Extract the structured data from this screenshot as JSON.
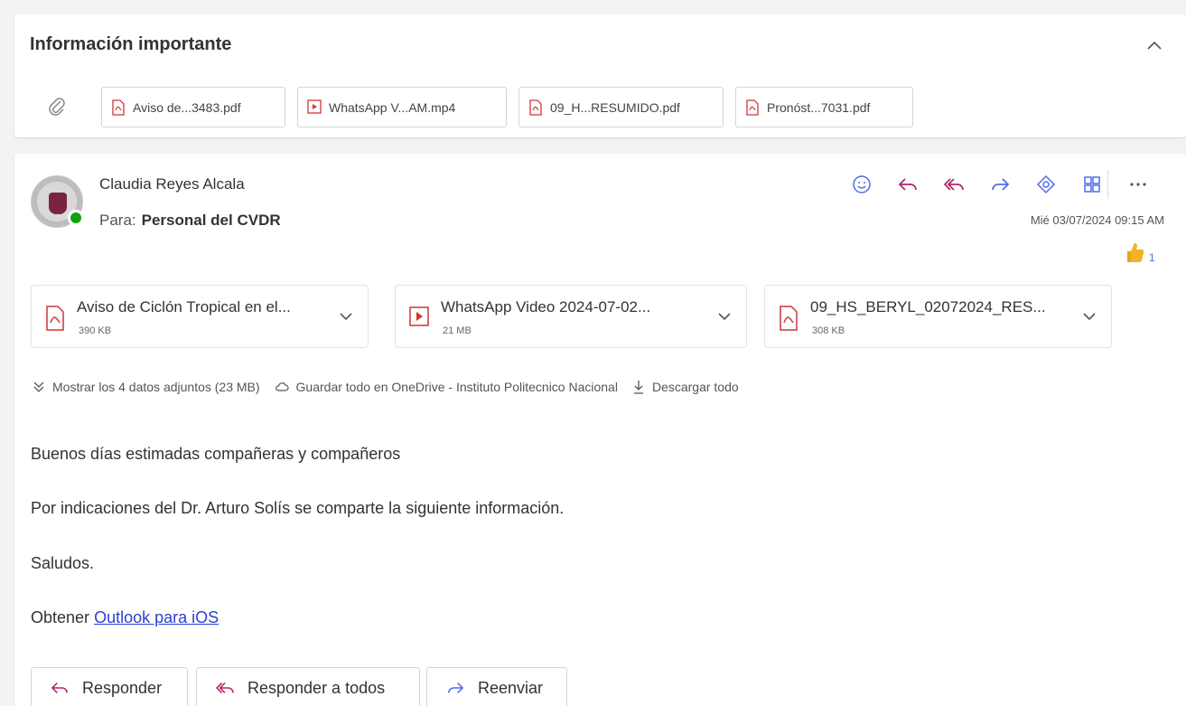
{
  "thread": {
    "subject": "Información importante",
    "attachment_chips": [
      {
        "label": "Aviso de...3483.pdf",
        "icon": "pdf-icon"
      },
      {
        "label": "WhatsApp V...AM.mp4",
        "icon": "video-icon"
      },
      {
        "label": "09_H...RESUMIDO.pdf",
        "icon": "pdf-icon"
      },
      {
        "label": "Pronóst...7031.pdf",
        "icon": "pdf-icon"
      }
    ]
  },
  "message": {
    "sender": "Claudia Reyes Alcala",
    "to_label": "Para:",
    "to_name": "Personal del CVDR",
    "date": "Mié 03/07/2024 09:15 AM",
    "reaction": {
      "emoji": "thumbs-up-icon",
      "count": "1"
    },
    "attachments": [
      {
        "name": "Aviso de Ciclón Tropical en el...",
        "size": "390 KB",
        "icon": "pdf-icon"
      },
      {
        "name": "WhatsApp Video 2024-07-02...",
        "size": "21 MB",
        "icon": "video-icon"
      },
      {
        "name": "09_HS_BERYL_02072024_RES...",
        "size": "308 KB",
        "icon": "pdf-icon"
      }
    ],
    "show_all_attachments": "Mostrar los 4 datos adjuntos (23 MB)",
    "save_onedrive": "Guardar todo en OneDrive - Instituto Politecnico Nacional",
    "download_all": "Descargar todo",
    "body": {
      "greeting": "Buenos días estimadas compañeras y compañeros",
      "line1": "Por indicaciones del Dr. Arturo Solís se comparte la siguiente información.",
      "closing": "Saludos.",
      "signature_prefix": "Obtener",
      "signature_link": "Outlook para iOS"
    },
    "footer_buttons": {
      "reply": "Responder",
      "reply_all": "Responder a todos",
      "forward": "Reenviar"
    }
  },
  "colors": {
    "accent": "#4f6bed",
    "presence": "#13a10e",
    "pdf": "#d13438",
    "link": "#2b3fd1"
  }
}
